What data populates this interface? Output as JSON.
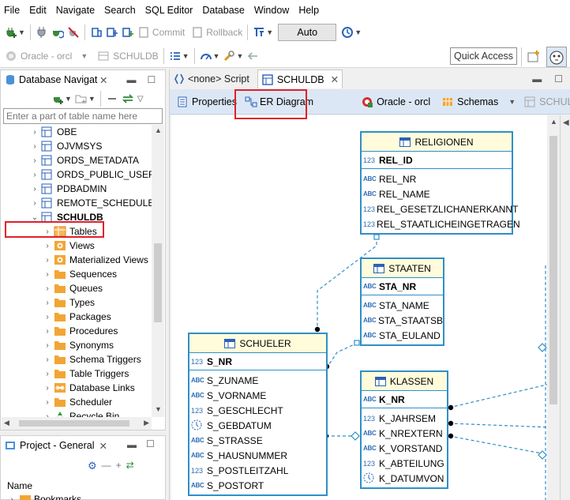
{
  "menubar": [
    "File",
    "Edit",
    "Navigate",
    "Search",
    "SQL Editor",
    "Database",
    "Window",
    "Help"
  ],
  "toolbar": {
    "commit_label": "Commit",
    "rollback_label": "Rollback",
    "auto_label": "Auto",
    "connection_label": "Oracle - orcl",
    "schema_label": "SCHULDB",
    "quick_access_label": "Quick Access"
  },
  "navigator": {
    "tab_label": "Database Navigator",
    "tab_label_shown": "Database Navigati",
    "filter_placeholder": "Enter a part of table name here",
    "items": [
      {
        "label": "OBE",
        "kind": "schema",
        "level": 1,
        "expanded": false
      },
      {
        "label": "OJVMSYS",
        "kind": "schema",
        "level": 1,
        "expanded": false
      },
      {
        "label": "ORDS_METADATA",
        "kind": "schema",
        "level": 1,
        "expanded": false
      },
      {
        "label": "ORDS_PUBLIC_USER",
        "kind": "schema",
        "level": 1,
        "expanded": false
      },
      {
        "label": "PDBADMIN",
        "kind": "schema",
        "level": 1,
        "expanded": false
      },
      {
        "label": "REMOTE_SCHEDULER_A",
        "kind": "schema",
        "level": 1,
        "expanded": false
      },
      {
        "label": "SCHULDB",
        "kind": "schema",
        "level": 1,
        "expanded": true,
        "bold": true
      },
      {
        "label": "Tables",
        "kind": "tables",
        "level": 2,
        "expanded": false
      },
      {
        "label": "Views",
        "kind": "views",
        "level": 2,
        "expanded": false
      },
      {
        "label": "Materialized Views",
        "kind": "views",
        "level": 2,
        "expanded": false
      },
      {
        "label": "Sequences",
        "kind": "folder",
        "level": 2,
        "expanded": false
      },
      {
        "label": "Queues",
        "kind": "folder",
        "level": 2,
        "expanded": false
      },
      {
        "label": "Types",
        "kind": "folder",
        "level": 2,
        "expanded": false
      },
      {
        "label": "Packages",
        "kind": "folder",
        "level": 2,
        "expanded": false
      },
      {
        "label": "Procedures",
        "kind": "folder",
        "level": 2,
        "expanded": false
      },
      {
        "label": "Synonyms",
        "kind": "folder",
        "level": 2,
        "expanded": false
      },
      {
        "label": "Schema Triggers",
        "kind": "folder",
        "level": 2,
        "expanded": false
      },
      {
        "label": "Table Triggers",
        "kind": "folder",
        "level": 2,
        "expanded": false
      },
      {
        "label": "Database Links",
        "kind": "link",
        "level": 2,
        "expanded": false
      },
      {
        "label": "Scheduler",
        "kind": "folder",
        "level": 2,
        "expanded": false
      },
      {
        "label": "Recycle Bin",
        "kind": "recycle",
        "level": 2,
        "expanded": false
      }
    ]
  },
  "project": {
    "tab_label": "Project - General",
    "column_header": "Name",
    "first_item": "Bookmarks"
  },
  "editor": {
    "tabs": [
      {
        "label": "<none> Script",
        "active": false
      },
      {
        "label": "SCHULDB",
        "active": true
      }
    ],
    "subtabs": {
      "properties": "Properties",
      "er_diagram": "ER Diagram",
      "connection": "Oracle - orcl",
      "schemas": "Schemas",
      "schema": "SCHULDB"
    }
  },
  "diagram": {
    "tables": [
      {
        "name": "RELIGIONEN",
        "pk": {
          "type": "123",
          "name": "REL_ID"
        },
        "columns": [
          {
            "type": "ABC",
            "name": "REL_NR"
          },
          {
            "type": "ABC",
            "name": "REL_NAME"
          },
          {
            "type": "123",
            "name": "REL_GESETZLICHANERKANNT"
          },
          {
            "type": "123",
            "name": "REL_STAATLICHEINGETRAGEN"
          }
        ]
      },
      {
        "name": "STAATEN",
        "pk": {
          "type": "ABC",
          "name": "STA_NR"
        },
        "columns": [
          {
            "type": "ABC",
            "name": "STA_NAME"
          },
          {
            "type": "ABC",
            "name": "STA_STAATSB"
          },
          {
            "type": "ABC",
            "name": "STA_EULAND"
          }
        ]
      },
      {
        "name": "SCHUELER",
        "pk": {
          "type": "123",
          "name": "S_NR"
        },
        "columns": [
          {
            "type": "ABC",
            "name": "S_ZUNAME"
          },
          {
            "type": "ABC",
            "name": "S_VORNAME"
          },
          {
            "type": "123",
            "name": "S_GESCHLECHT"
          },
          {
            "type": "date",
            "name": "S_GEBDATUM"
          },
          {
            "type": "ABC",
            "name": "S_STRASSE"
          },
          {
            "type": "ABC",
            "name": "S_HAUSNUMMER"
          },
          {
            "type": "123",
            "name": "S_POSTLEITZAHL"
          },
          {
            "type": "ABC",
            "name": "S_POSTORT"
          }
        ]
      },
      {
        "name": "KLASSEN",
        "pk": {
          "type": "ABC",
          "name": "K_NR"
        },
        "columns": [
          {
            "type": "123",
            "name": "K_JAHRSEM"
          },
          {
            "type": "ABC",
            "name": "K_NREXTERN"
          },
          {
            "type": "ABC",
            "name": "K_VORSTAND"
          },
          {
            "type": "123",
            "name": "K_ABTEILUNG"
          },
          {
            "type": "date",
            "name": "K_DATUMVON"
          }
        ]
      }
    ]
  },
  "colors": {
    "highlight": "#e0202a",
    "entity_border": "#2f8fc8",
    "entity_header": "#fffbdb",
    "relation_line": "#2f8fc8"
  }
}
